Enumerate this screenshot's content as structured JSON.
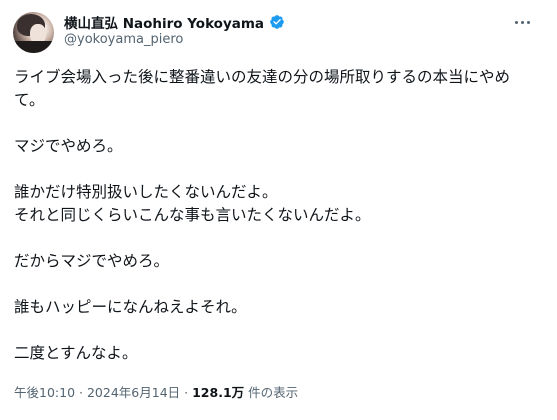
{
  "author": {
    "display_name": "横山直弘 Naohiro Yokoyama",
    "handle": "@yokoyama_piero",
    "verified_badge_color": "#1d9bf0",
    "verified_icon": "verified-badge-icon"
  },
  "tweet": {
    "paragraphs": [
      "ライブ会場入った後に整番違いの友達の分の場所取りするの本当にやめ\nて。",
      "マジでやめろ。",
      "誰かだけ特別扱いしたくないんだよ。\nそれと同じくらいこんな事も言いたくないんだよ。",
      "だからマジでやめろ。",
      "誰もハッピーになんねえよそれ。",
      "二度とすんなよ。"
    ],
    "time": "午後10:10",
    "separator": "·",
    "date": "2024年6月14日",
    "views_count": "128.1万",
    "views_label": "件の表示"
  },
  "menu": {
    "icon": "more-horizontal-icon"
  }
}
